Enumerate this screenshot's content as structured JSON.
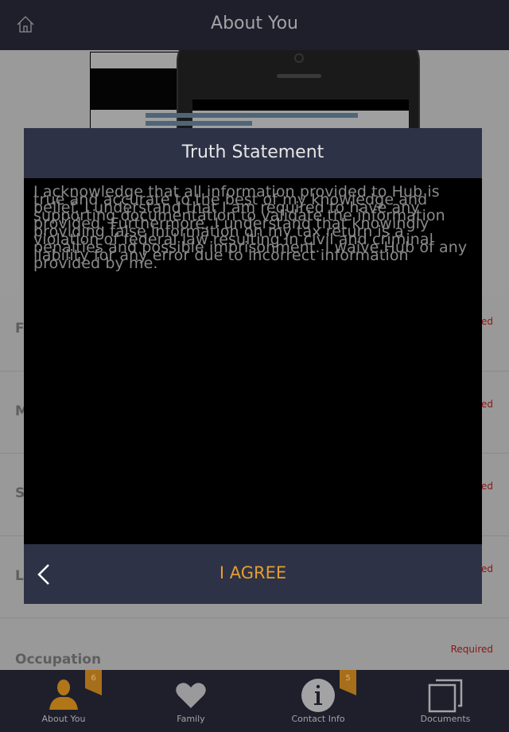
{
  "header": {
    "title": "About You",
    "home_icon": "home-icon"
  },
  "form": {
    "rows": [
      {
        "label": "F",
        "status": "Required"
      },
      {
        "label": "M",
        "status": "Required"
      },
      {
        "label": "S",
        "status": "Required"
      },
      {
        "label": "L",
        "status": "Required"
      },
      {
        "label": "Occupation",
        "status": "Required"
      }
    ]
  },
  "modal": {
    "title": "Truth Statement",
    "body": "I acknowledge that all information provided to Hub is true and accurate to the best of my knowledge and belief. I understand that I am required to have any supporting documentation to validate the information provided. Furthermore, I understand that knowingly providing false information on my tax return is a violation of federal law resulting in civil and criminal penalties and possible imprisonment. I waive Hub of any liability for any error due to incorrect information provided by me.",
    "agree_label": "I AGREE",
    "back_icon": "chevron-left-icon"
  },
  "tabs": [
    {
      "label": "About You",
      "icon": "person-icon",
      "badge": "6",
      "active": true
    },
    {
      "label": "Family",
      "icon": "heart-icon",
      "badge": null,
      "active": false
    },
    {
      "label": "Contact Info",
      "icon": "info-icon",
      "badge": "5",
      "active": false
    },
    {
      "label": "Documents",
      "icon": "documents-icon",
      "badge": null,
      "active": false
    }
  ],
  "colors": {
    "header_bg": "#1e1f2b",
    "modal_bar": "#2e3246",
    "accent": "#e69d2f",
    "badge": "#a86f1a",
    "required": "#8b1414"
  }
}
